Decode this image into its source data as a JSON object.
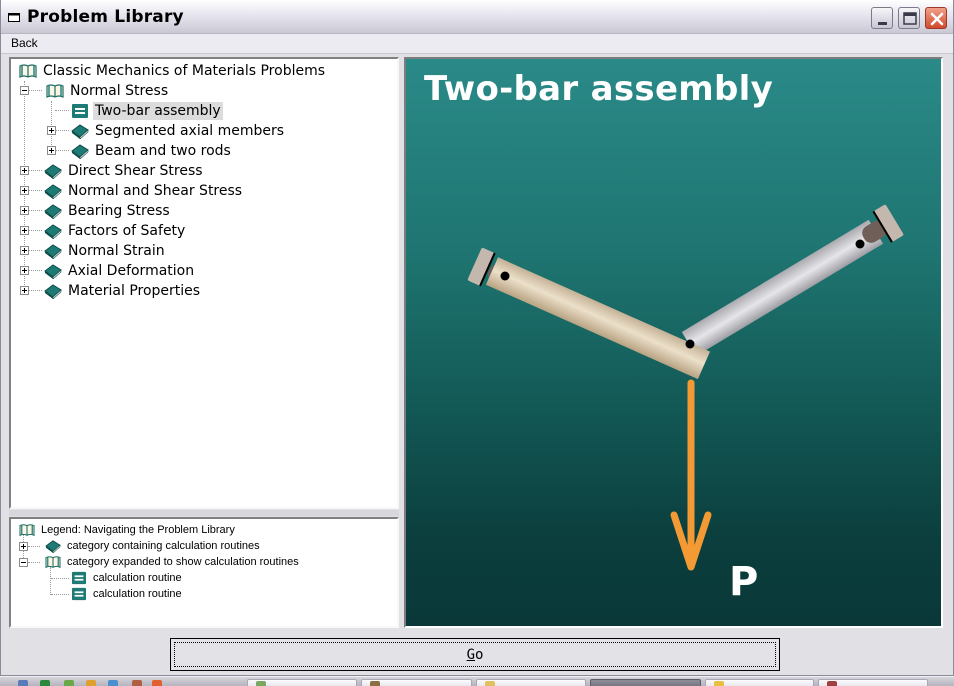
{
  "window": {
    "title": "Problem Library",
    "controls": [
      "minimize",
      "maximize",
      "close"
    ]
  },
  "menu": {
    "back_label": "Back"
  },
  "tree": {
    "root": {
      "label": "Classic Mechanics of Materials Problems",
      "icon": "open-book-icon"
    },
    "items": [
      {
        "label": "Normal Stress",
        "icon": "open-book-icon",
        "expander": "minus",
        "level": 1
      },
      {
        "label": "Two-bar assembly",
        "icon": "calculation-routine-icon",
        "expander": "none",
        "level": 2,
        "selected": true
      },
      {
        "label": "Segmented axial members",
        "icon": "closed-book-icon",
        "expander": "plus",
        "level": 2
      },
      {
        "label": "Beam and two rods",
        "icon": "closed-book-icon",
        "expander": "plus",
        "level": 2
      },
      {
        "label": "Direct Shear Stress",
        "icon": "closed-book-icon",
        "expander": "plus",
        "level": 1
      },
      {
        "label": "Normal and Shear Stress",
        "icon": "closed-book-icon",
        "expander": "plus",
        "level": 1
      },
      {
        "label": "Bearing Stress",
        "icon": "closed-book-icon",
        "expander": "plus",
        "level": 1
      },
      {
        "label": "Factors of Safety",
        "icon": "closed-book-icon",
        "expander": "plus",
        "level": 1
      },
      {
        "label": "Normal Strain",
        "icon": "closed-book-icon",
        "expander": "plus",
        "level": 1
      },
      {
        "label": "Axial Deformation",
        "icon": "closed-book-icon",
        "expander": "plus",
        "level": 1
      },
      {
        "label": "Material Properties",
        "icon": "closed-book-icon",
        "expander": "plus",
        "level": 1
      }
    ]
  },
  "legend": {
    "title": "Legend:  Navigating the Problem Library",
    "items": [
      {
        "label": "category containing calculation routines",
        "icon": "closed-book-icon",
        "expander": "plus"
      },
      {
        "label": "category expanded to show calculation routines",
        "icon": "open-book-icon",
        "expander": "minus"
      },
      {
        "label": "calculation routine",
        "icon": "calculation-routine-icon"
      },
      {
        "label": "calculation routine",
        "icon": "calculation-routine-icon"
      }
    ]
  },
  "content": {
    "title": "Two-bar assembly",
    "load_label": "P",
    "colors": {
      "background_top": "#2a8a88",
      "background_bottom": "#0a3838",
      "load_arrow": "#f39a35",
      "bar_left": "#d9c8ac",
      "bar_right": "#c4c4c8"
    }
  },
  "actions": {
    "go_label_underlined": "G",
    "go_label_rest": "o"
  },
  "colors": {
    "accent_teal": "#1e7a74",
    "selected_row": "#dcdcdc"
  }
}
